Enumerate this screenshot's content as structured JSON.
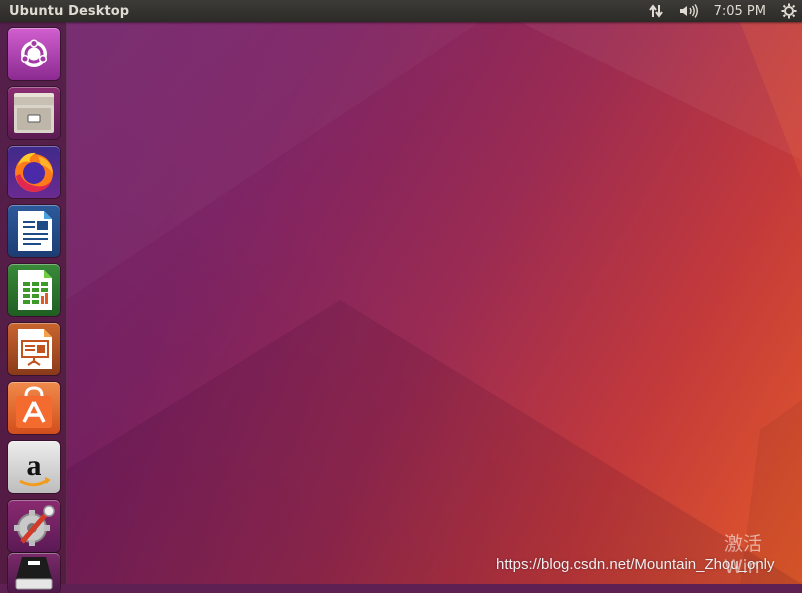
{
  "topbar": {
    "title": "Ubuntu Desktop",
    "clock": "7:05 PM",
    "indicators": [
      "network-icon",
      "volume-icon",
      "settings-gear-icon"
    ]
  },
  "launcher": {
    "items": [
      {
        "name": "ubuntu-dash",
        "icon": "ubuntu-logo-icon"
      },
      {
        "name": "files",
        "icon": "file-cabinet-icon"
      },
      {
        "name": "firefox",
        "icon": "firefox-icon"
      },
      {
        "name": "libreoffice-writer",
        "icon": "writer-document-icon"
      },
      {
        "name": "libreoffice-calc",
        "icon": "calc-spreadsheet-icon"
      },
      {
        "name": "libreoffice-impress",
        "icon": "impress-presentation-icon"
      },
      {
        "name": "ubuntu-software",
        "icon": "software-bag-icon"
      },
      {
        "name": "amazon",
        "icon": "amazon-icon"
      },
      {
        "name": "system-settings",
        "icon": "settings-tools-icon"
      },
      {
        "name": "drive",
        "icon": "drive-icon"
      }
    ]
  },
  "overlay": {
    "watermark": "激活 Win",
    "url": "https://blog.csdn.net/Mountain_Zhou_only"
  },
  "colors": {
    "topbar": "#3c3b37",
    "topbar_text": "#dfdbd2",
    "wallpaper_left": "#6a1e6a",
    "wallpaper_right": "#e25a2a"
  }
}
